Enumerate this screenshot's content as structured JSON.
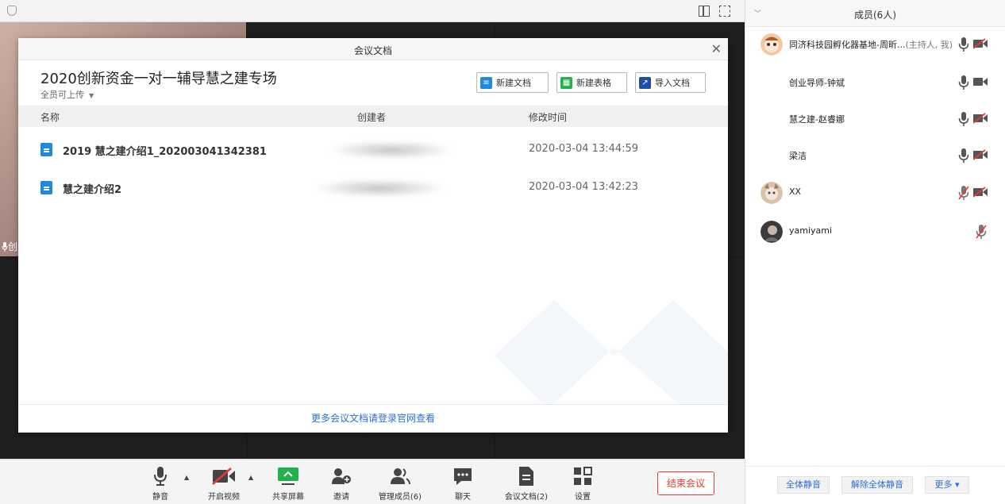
{
  "dialog": {
    "title": "会议文档",
    "meeting_title": "2020创新资金一对一辅导慧之建专场",
    "upload_permission": "全员可上传",
    "buttons": {
      "new_doc": "新建文档",
      "new_sheet": "新建表格",
      "import_doc": "导入文档"
    },
    "columns": {
      "name": "名称",
      "creator": "创建者",
      "modified": "修改时间"
    },
    "files": [
      {
        "name": "2019 慧之建介绍1_202003041342381",
        "modified": "2020-03-04 13:44:59"
      },
      {
        "name": "慧之建介绍2",
        "modified": "2020-03-04 13:42:23"
      }
    ],
    "footer_link": "更多会议文档请登录官网查看"
  },
  "video": {
    "tile_name_fragment": "创"
  },
  "toolbar": {
    "mute": "静音",
    "start_video": "开启视频",
    "share_screen": "共享屏幕",
    "invite": "邀请",
    "manage_members": "管理成员(6)",
    "chat": "聊天",
    "meeting_docs": "会议文档(2)",
    "settings": "设置",
    "end_meeting": "结束会议"
  },
  "panel": {
    "title": "成员(6人)",
    "members": [
      {
        "name": "同济科技园孵化器基地-周昕...",
        "role": "(主持人, 我)",
        "mic": "on",
        "camera": "off",
        "avatar": "cartoon"
      },
      {
        "name": "创业导师-钟斌",
        "mic": "on",
        "camera": "on",
        "avatar": "none"
      },
      {
        "name": "慧之建-赵睿娜",
        "mic": "on",
        "camera": "off",
        "avatar": "none"
      },
      {
        "name": "梁洁",
        "mic": "on",
        "camera": "off",
        "avatar": "none"
      },
      {
        "name": "XX",
        "mic": "muted",
        "camera": "off",
        "avatar": "cat"
      },
      {
        "name": "yamiyami",
        "mic": "muted",
        "camera": "none",
        "avatar": "photo"
      }
    ],
    "buttons": {
      "mute_all": "全体静音",
      "unmute_all": "解除全体静音",
      "more": "更多 ▾"
    }
  },
  "colors": {
    "accent_blue": "#2b6fd6",
    "end_red": "#e53935",
    "doc_blue": "#1e88e5",
    "sheet_green": "#22b14c"
  }
}
